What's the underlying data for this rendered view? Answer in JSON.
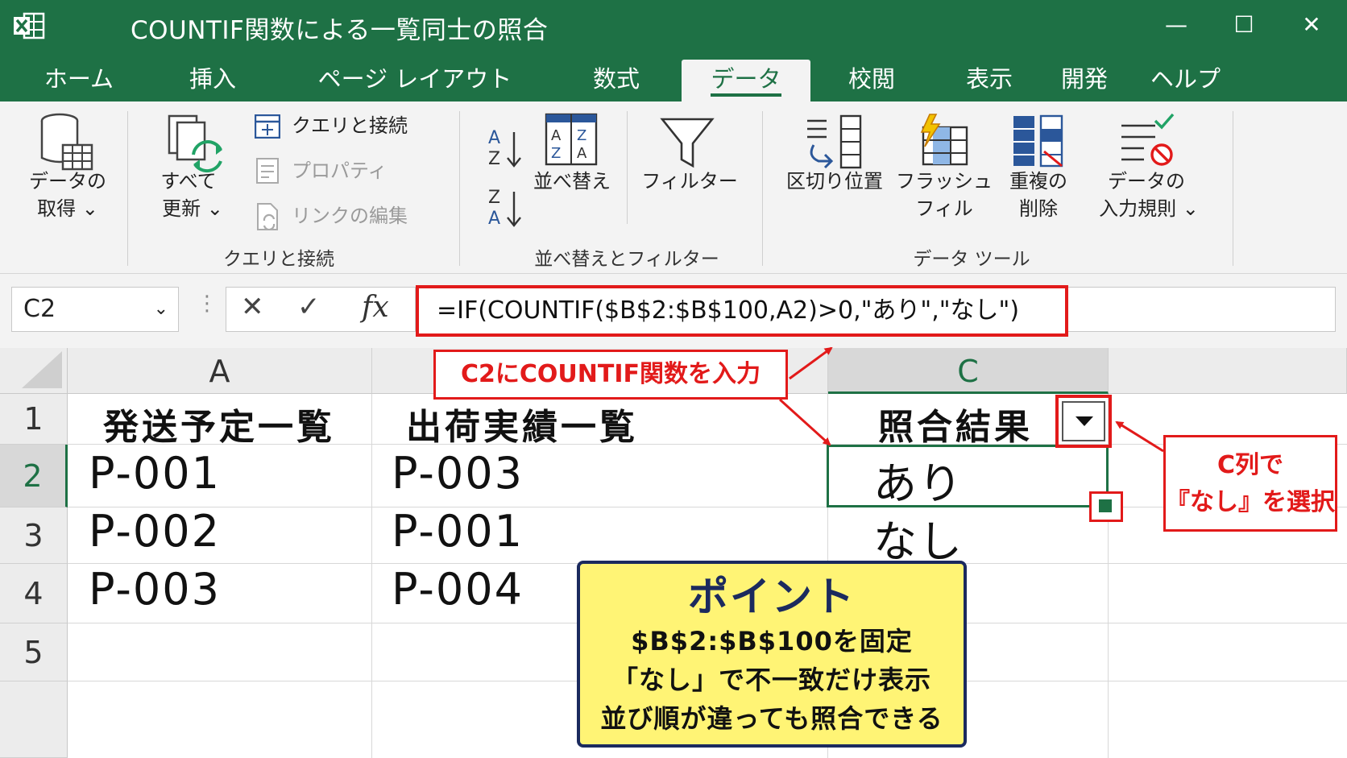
{
  "window": {
    "title": "COUNTIF関数による一覧同士の照合",
    "controls": {
      "minimize": "—",
      "maximize": "☐",
      "close": "✕"
    }
  },
  "tabs": [
    "ホーム",
    "挿入",
    "ページ レイアウト",
    "数式",
    "データ",
    "校閲",
    "表示",
    "開発",
    "ヘルプ"
  ],
  "active_tab": "データ",
  "ribbon": {
    "get_data": {
      "line1": "データの",
      "line2": "取得 ⌄"
    },
    "refresh_all": {
      "line1": "すべて",
      "line2": "更新 ⌄"
    },
    "queries_connections": "クエリと接続",
    "properties": "プロパティ",
    "edit_links": "リンクの編集",
    "group_queries": "クエリと接続",
    "sort": "並べ替え",
    "filter": "フィルター",
    "group_sort_filter": "並べ替えとフィルター",
    "text_to_columns": "区切り位置",
    "flash_fill": {
      "line1": "フラッシュ",
      "line2": "フィル"
    },
    "remove_duplicates": {
      "line1": "重複の",
      "line2": "削除"
    },
    "data_validation": {
      "line1": "データの",
      "line2": "入力規則 ⌄"
    },
    "group_data_tools": "データ ツール"
  },
  "formula_bar": {
    "name_box": "C2",
    "cancel": "✕",
    "enter": "✓",
    "fx": "fx",
    "formula": "=IF(COUNTIF($B$2:$B$100,A2)>0,\"あり\",\"なし\")"
  },
  "sheet": {
    "columns": [
      "A",
      "",
      "C"
    ],
    "rows": [
      "1",
      "2",
      "3",
      "4",
      "5"
    ],
    "cells": {
      "A1": "発送予定一覧",
      "B1": "出荷実績一覧",
      "C1": "照合結果",
      "A2": "P-001",
      "B2": "P-003",
      "C2": "あり",
      "A3": "P-002",
      "B3": "P-001",
      "C3": "なし",
      "A4": "P-003",
      "B4": "P-004"
    }
  },
  "callouts": {
    "formula_note": "C2にCOUNTIF関数を入力",
    "filter_note_line1": "C列で",
    "filter_note_line2": "『なし』を選択"
  },
  "point_box": {
    "title": "ポイント",
    "lines": [
      "$B$2:$B$100を固定",
      "「なし」で不一致だけ表示",
      "並び順が違っても照合できる"
    ]
  },
  "colors": {
    "excel_green": "#1e7145",
    "callout_red": "#e21a1a",
    "point_yellow": "#fff475",
    "point_border": "#1b2a5e"
  }
}
